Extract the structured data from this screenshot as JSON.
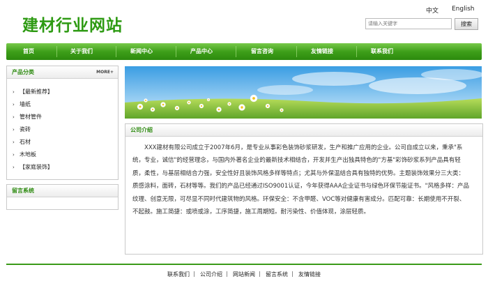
{
  "header": {
    "site_title": "建材行业网站",
    "lang_zh": "中文",
    "lang_en": "English",
    "search_placeholder": "请输入关键字",
    "search_button": "搜索"
  },
  "nav": [
    "首页",
    "关于我们",
    "新闻中心",
    "产品中心",
    "留言咨询",
    "友情链接",
    "联系我们"
  ],
  "sidebar": {
    "categories_title": "产品分类",
    "more_label": "MORE+",
    "categories": [
      "【最新推荐】",
      "墙纸",
      "管材管件",
      "瓷砖",
      "石材",
      "木地板",
      "【家庭装饰】"
    ],
    "guestbook_title": "留言系统"
  },
  "intro": {
    "title": "公司介绍",
    "text": "XXX建材有限公司成立于2007年6月，是专业从事彩色装饰砂浆研发，生产和推广应用的企业。公司自成立以来，秉承\"系统，专业，诚信\"的经营理念，与国内外著名企业的最新技术相结合，开发并生产出独具特色的\"方基\"彩饰砂浆系列产品具有轻质，柔性，与基层相结合力强，安全性好且装饰风格多样等特点；尤其与外保温结合具有独特的优势。主题装饰效果分三大类：质感涂料，面砖，石材等等。我们的产品已经通过ISO9001认证，今年获得AAA企业证书与绿色环保节能证书。\"风格多样：产品纹理、创意无限，可尽显不同时代建筑物的风格。环保安全：不含甲醛、VOC等对健康有害成分。匹配可靠：长期使用不开裂、不起鼓。施工简捷：或喷或涂，工序简捷，施工周期短。耐污染性、价值体现，涂层轻质。"
  },
  "footer": [
    "联系我们",
    "公司介绍",
    "网站新闻",
    "留言系统",
    "友情链接"
  ],
  "colors": {
    "brand_green": "#2d9a12",
    "nav_green": "#3e9f1a",
    "sky": "#5cb3ea",
    "grass": "#8cc63f"
  }
}
